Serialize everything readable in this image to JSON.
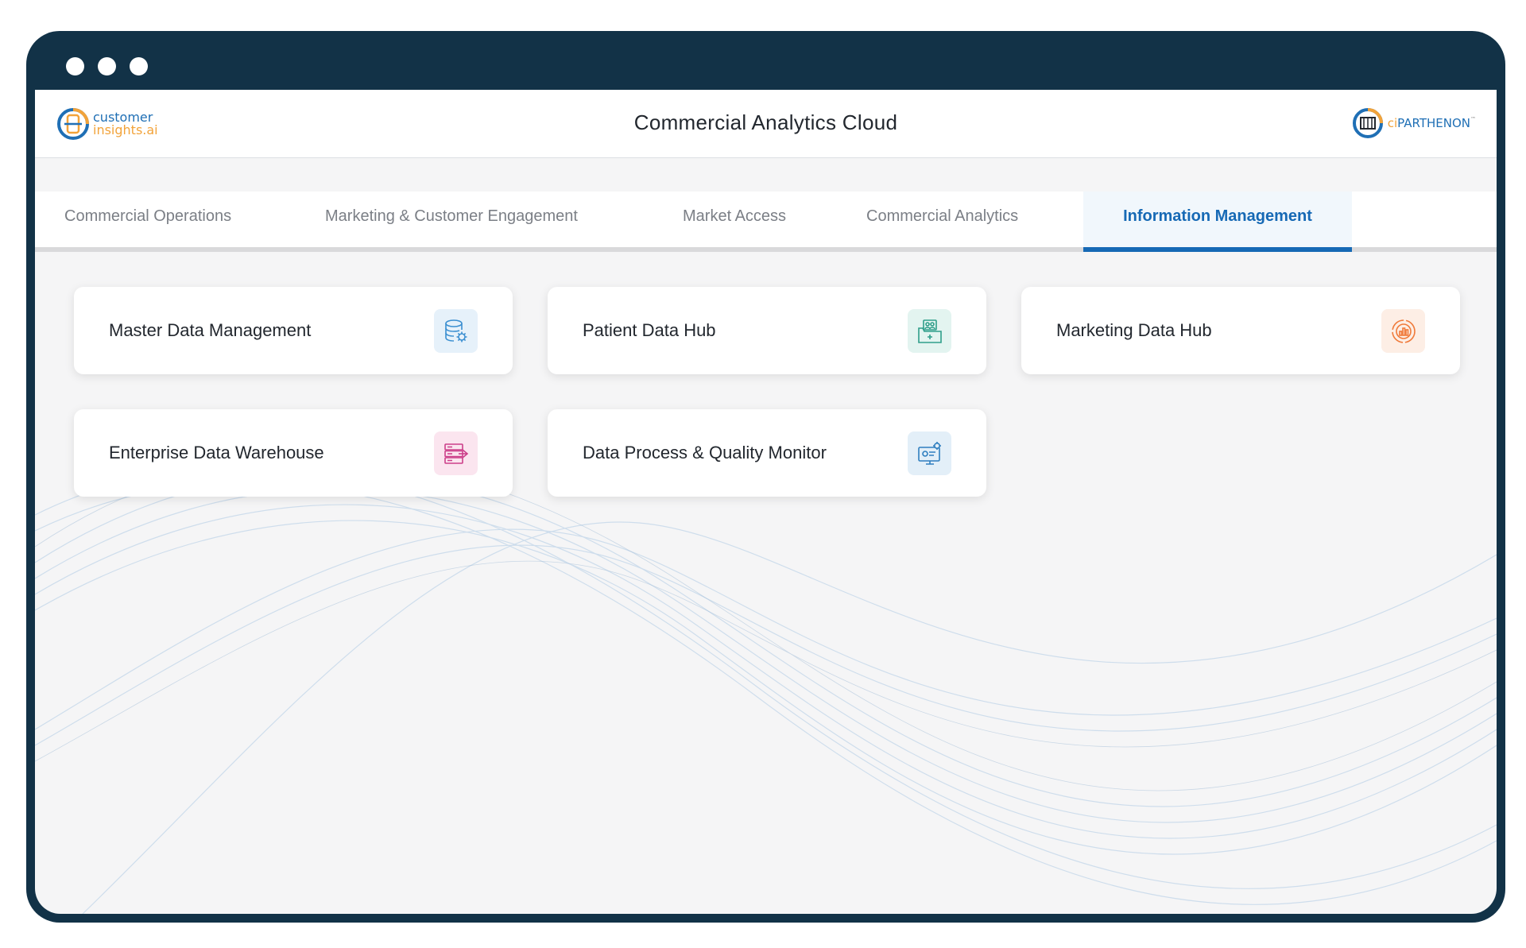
{
  "window": {
    "controls": [
      "close",
      "minimize",
      "maximize"
    ]
  },
  "header": {
    "title": "Commercial Analytics Cloud",
    "left_brand": {
      "line1": "customer",
      "line2": "insights.ai",
      "icon": "customer-insights-logo-icon"
    },
    "right_brand": {
      "prefix": "ci",
      "name": "PARTHENON",
      "tm": "™",
      "icon": "parthenon-logo-icon"
    }
  },
  "tabs": [
    {
      "label": "Commercial Operations",
      "active": false
    },
    {
      "label": "Marketing & Customer Engagement",
      "active": false
    },
    {
      "label": "Market Access",
      "active": false
    },
    {
      "label": "Commercial Analytics",
      "active": false
    },
    {
      "label": "Information Management",
      "active": true
    }
  ],
  "cards": [
    {
      "label": "Master Data Management",
      "icon": "database-gear-icon",
      "icon_color": "#3b8fd1",
      "icon_bg": "#e6f1fa"
    },
    {
      "label": "Patient Data Hub",
      "icon": "patient-records-icon",
      "icon_color": "#2f9e8a",
      "icon_bg": "#e3f4f0"
    },
    {
      "label": "Marketing Data Hub",
      "icon": "marketing-target-chart-icon",
      "icon_color": "#f07a3a",
      "icon_bg": "#fdeee5"
    },
    {
      "label": "Enterprise Data Warehouse",
      "icon": "server-stack-icon",
      "icon_color": "#cc3f8a",
      "icon_bg": "#fbe5ef"
    },
    {
      "label": "Data Process & Quality Monitor",
      "icon": "monitor-gear-icon",
      "icon_color": "#2f7fbf",
      "icon_bg": "#e3eff8"
    }
  ],
  "colors": {
    "frame": "#123247",
    "accent": "#1669b5",
    "background": "#f5f5f6"
  }
}
